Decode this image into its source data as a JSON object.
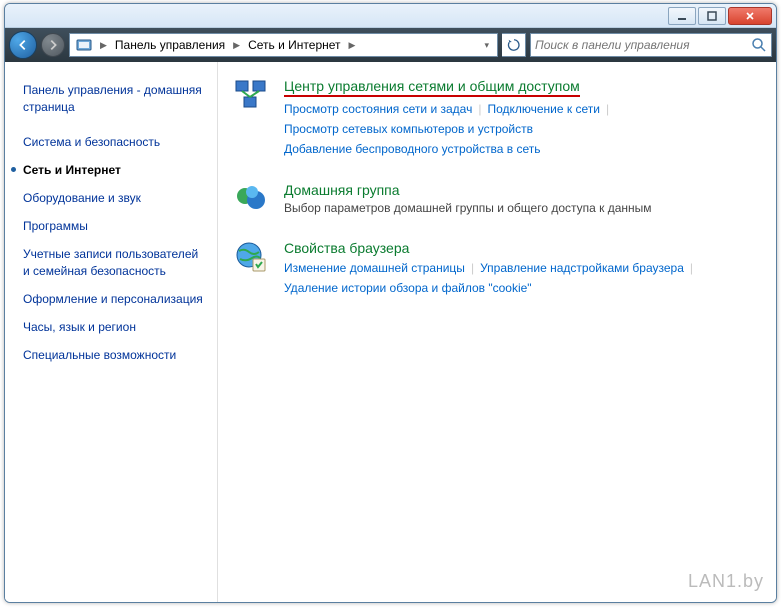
{
  "titlebar": {
    "min_tooltip": "Свернуть",
    "max_tooltip": "Развернуть",
    "close_tooltip": "Закрыть"
  },
  "nav": {
    "breadcrumb": [
      "Панель управления",
      "Сеть и Интернет"
    ],
    "search_placeholder": "Поиск в панели управления"
  },
  "sidebar": {
    "home": "Панель управления - домашняя страница",
    "items": [
      {
        "label": "Система и безопасность",
        "active": false
      },
      {
        "label": "Сеть и Интернет",
        "active": true
      },
      {
        "label": "Оборудование и звук",
        "active": false
      },
      {
        "label": "Программы",
        "active": false
      },
      {
        "label": "Учетные записи пользователей и семейная безопасность",
        "active": false
      },
      {
        "label": "Оформление и персонализация",
        "active": false
      },
      {
        "label": "Часы, язык и регион",
        "active": false
      },
      {
        "label": "Специальные возможности",
        "active": false
      }
    ]
  },
  "sections": [
    {
      "title": "Центр управления сетями и общим доступом",
      "highlight": true,
      "links": [
        [
          "Просмотр состояния сети и задач",
          "Подключение к сети"
        ],
        [
          "Просмотр сетевых компьютеров и устройств"
        ],
        [
          "Добавление беспроводного устройства в сеть"
        ]
      ]
    },
    {
      "title": "Домашняя группа",
      "subtitle": "Выбор параметров домашней группы и общего доступа к данным",
      "links": []
    },
    {
      "title": "Свойства браузера",
      "links": [
        [
          "Изменение домашней страницы",
          "Управление надстройками браузера"
        ],
        [
          "Удаление истории обзора и файлов \"cookie\""
        ]
      ]
    }
  ],
  "watermark": "LAN1.by"
}
